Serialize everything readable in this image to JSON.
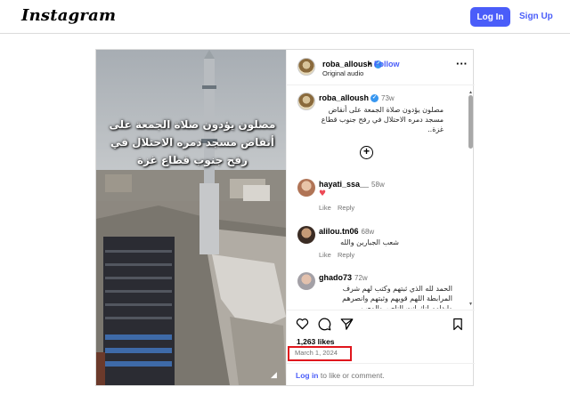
{
  "header": {
    "logo_text": "Instagram",
    "login_label": "Log In",
    "signup_label": "Sign Up"
  },
  "post": {
    "overlay_caption": "مصلون يؤدون صلاة الجمعة على أنقاض مسجد دمره الاحتلال في رفح جنوب قطاع غزة",
    "author": {
      "username": "roba_alloush",
      "verified": true,
      "follow_label": "Follow",
      "audio": "Original audio"
    },
    "caption": {
      "username": "roba_alloush",
      "age": "73w",
      "text": "مصلون يؤدون صلاة الجمعة على أنقاض مسجد دمره الاحتلال في رفح جنوب قطاع غزة.."
    },
    "comments": [
      {
        "username": "hayati_ssa__",
        "age": "58w",
        "text": "♥",
        "like_label": "Like",
        "reply_label": "Reply"
      },
      {
        "username": "alilou.tn06",
        "age": "68w",
        "text": "شعب الجبارين والله",
        "like_label": "Like",
        "reply_label": "Reply"
      },
      {
        "username": "ghado73",
        "age": "72w",
        "text": "الحمد لله الذي ثبتهم وكتب لهم شرف المرابطة اللهم قويهم وثبتهم وانصرهم وابدلهم انك انت الناصر والمعين"
      }
    ],
    "likes": "1,263 likes",
    "date": "March 1, 2024",
    "login_prompt": {
      "link": "Log in",
      "rest": " to like or comment."
    }
  },
  "colors": {
    "accent": "#4a5df9",
    "highlight_box": "#e0161d",
    "muted_text": "#737373"
  }
}
